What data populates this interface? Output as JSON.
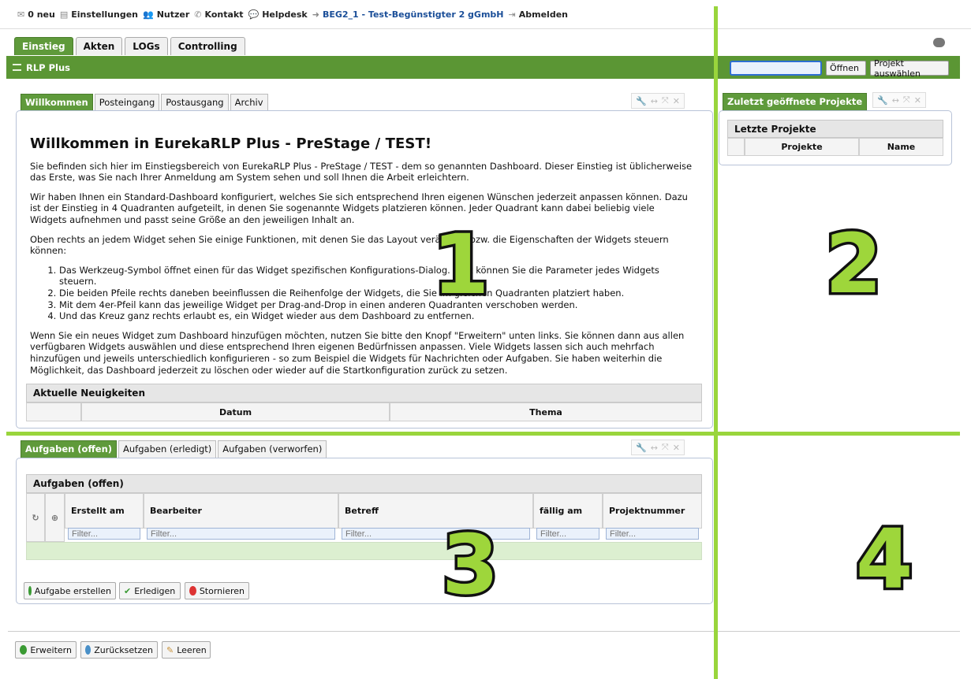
{
  "topbar": {
    "messages": "0 neu",
    "settings": "Einstellungen",
    "users": "Nutzer",
    "contact": "Kontakt",
    "helpdesk": "Helpdesk",
    "project": "BEG2_1 - Test-Begünstigter 2 gGmbH",
    "logout": "Abmelden"
  },
  "main_tabs": [
    "Einstieg",
    "Akten",
    "LOGs",
    "Controlling"
  ],
  "section": {
    "title": "RLP Plus"
  },
  "project_bar": {
    "input_value": "",
    "open_button": "Öffnen",
    "select_button": "Projekt auswählen"
  },
  "widget1": {
    "tabs": [
      "Willkommen",
      "Posteingang",
      "Postausgang",
      "Archiv"
    ],
    "heading": "Willkommen in EurekaRLP Plus - PreStage / TEST!",
    "p1": "Sie befinden sich hier im Einstiegsbereich von EurekaRLP Plus - PreStage / TEST - dem so genannten Dashboard. Dieser Einstieg ist üblicherweise das Erste, was Sie nach Ihrer Anmeldung am System sehen und soll Ihnen die Arbeit erleichtern.",
    "p2": "Wir haben Ihnen ein Standard-Dashboard konfiguriert, welches Sie sich entsprechend Ihren eigenen Wünschen jederzeit anpassen können. Dazu ist der Einstieg in 4 Quadranten aufgeteilt, in denen Sie sogenannte Widgets platzieren können. Jeder Quadrant kann dabei beliebig viele Widgets aufnehmen und passt seine Größe an den jeweiligen Inhalt an.",
    "p3": "Oben rechts an jedem Widget sehen Sie einige Funktionen, mit denen Sie das Layout verändern bzw. die Eigenschaften der Widgets steuern können:",
    "list": [
      "Das Werkzeug-Symbol öffnet einen für das Widget spezifischen Konfigurations-Dialog. Dort können Sie die Parameter jedes Widgets steuern.",
      "Die beiden Pfeile rechts daneben beeinflussen die Reihenfolge der Widgets, die Sie im gleichen Quadranten platziert haben.",
      "Mit dem 4er-Pfeil kann das jeweilige Widget per Drag-and-Drop in einen anderen Quadranten verschoben werden.",
      "Und das Kreuz ganz rechts erlaubt es, ein Widget wieder aus dem Dashboard zu entfernen."
    ],
    "p4": "Wenn Sie ein neues Widget zum Dashboard hinzufügen möchten, nutzen Sie bitte den Knopf \"Erweitern\" unten links. Sie können dann aus allen verfügbaren Widgets auswählen und diese entsprechend Ihren eigenen Bedürfnissen anpassen. Viele Widgets lassen sich auch mehrfach hinzufügen und jeweils unterschiedlich konfigurieren - so zum Beispiel die Widgets für Nachrichten oder Aufgaben. Sie haben weiterhin die Möglichkeit, das Dashboard jederzeit zu löschen oder wieder auf die Startkonfiguration zurück zu setzen.",
    "news_title": "Aktuelle Neuigkeiten",
    "news_cols": [
      "Datum",
      "Thema"
    ]
  },
  "widget2": {
    "tab": "Zuletzt geöffnete Projekte",
    "grid_title": "Letzte Projekte",
    "cols": [
      "Projekte",
      "Name"
    ]
  },
  "widget3": {
    "tabs": [
      "Aufgaben (offen)",
      "Aufgaben (erledigt)",
      "Aufgaben (verworfen)"
    ],
    "grid_title": "Aufgaben (offen)",
    "cols": [
      "Erstellt am",
      "Bearbeiter",
      "Betreff",
      "fällig am",
      "Projektnummer"
    ],
    "filter_placeholder": "Filter...",
    "buttons": [
      "Aufgabe erstellen",
      "Erledigen",
      "Stornieren"
    ]
  },
  "footer_buttons": [
    "Erweitern",
    "Zurücksetzen",
    "Leeren"
  ],
  "quadrant_labels": [
    "1",
    "2",
    "3",
    "4"
  ],
  "colors": {
    "accent_green": "#5b9634",
    "overlay_green": "#99d53c",
    "link_blue": "#1a4e98"
  }
}
